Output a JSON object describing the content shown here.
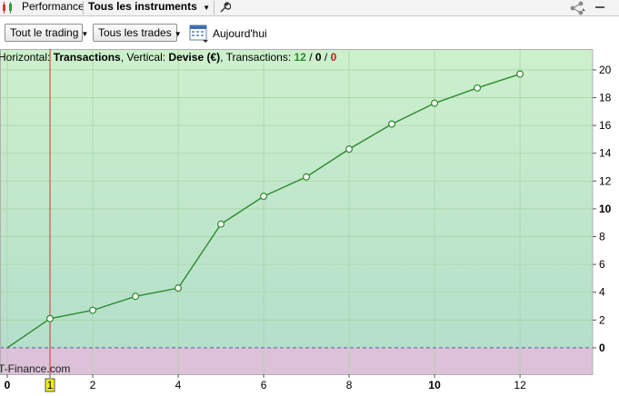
{
  "topbar": {
    "performance_label": "Performance",
    "instruments_label": "Tous les instruments"
  },
  "toolbar": {
    "trading_filter": "Tout le trading",
    "trades_filter": "Tous les trades",
    "date_label": "Aujourd'hui"
  },
  "chart_info": {
    "prefix": "Horizontal: ",
    "x_name": "Transactions",
    "mid": ", Vertical: ",
    "y_name": "Devise (€)",
    "count_label": ", Transactions: ",
    "total": "12",
    "sep1": " / ",
    "wins": "0",
    "sep2": " / ",
    "losses": "0"
  },
  "watermark": "T-Finance.com",
  "colors": {
    "profit_zone_top": "#cdf0cc",
    "profit_zone_bottom": "#b4dfcb",
    "loss_zone": "#dcc1d8",
    "line": "#2f8a2f",
    "cursor": "#e03030",
    "zero_line": "#5a5aa8"
  },
  "chart_data": {
    "type": "line",
    "x": [
      0,
      1,
      2,
      3,
      4,
      5,
      6,
      7,
      8,
      9,
      10,
      11,
      12
    ],
    "series": [
      {
        "values": [
          0,
          2.1,
          2.7,
          3.7,
          4.3,
          8.9,
          10.9,
          12.3,
          14.3,
          16.1,
          17.6,
          18.7,
          19.7
        ]
      }
    ],
    "xlim": [
      0,
      13.7
    ],
    "ylim": [
      -1.9,
      21.5
    ],
    "x_ticks": [
      "0",
      "1",
      "2",
      "4",
      "6",
      "8",
      "10",
      "12"
    ],
    "y_ticks": [
      "0",
      "2",
      "4",
      "6",
      "8",
      "10",
      "12",
      "14",
      "16",
      "18",
      "20"
    ],
    "highlighted_x": "1",
    "grid": true
  }
}
